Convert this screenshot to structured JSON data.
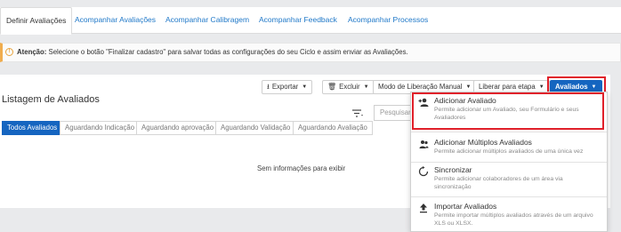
{
  "tabs": [
    {
      "label": "Definir Avaliações",
      "active": true
    },
    {
      "label": "Acompanhar Avaliações",
      "active": false
    },
    {
      "label": "Acompanhar Calibragem",
      "active": false
    },
    {
      "label": "Acompanhar Feedback",
      "active": false
    },
    {
      "label": "Acompanhar Processos",
      "active": false
    }
  ],
  "alert": {
    "icon": "info-icon",
    "title": "Atenção:",
    "text": " Selecione o botão \"Finalizar cadastro\" para salvar todas as configurações do seu Ciclo e assim enviar as Avaliações."
  },
  "panel": {
    "title": "Listagem de Avaliados",
    "toolbar": {
      "export_label": "Exportar",
      "delete_label": "Excluir",
      "release_mode_label": "Modo de Liberação Manual",
      "release_stage_label": "Liberar para etapa",
      "evaluated_label": "Avaliados"
    },
    "search_placeholder": "Pesquisar",
    "subtabs": [
      {
        "label": "Todos Avaliados",
        "active": true
      },
      {
        "label": "Aguardando Indicação",
        "active": false
      },
      {
        "label": "Aguardando aprovação",
        "active": false
      },
      {
        "label": "Aguardando Validação",
        "active": false
      },
      {
        "label": "Aguardando Avaliação",
        "active": false
      }
    ],
    "empty_message": "Sem informações para exibir"
  },
  "menu": {
    "items": [
      {
        "icon": "add-person-icon",
        "title": "Adicionar Avaliado",
        "description": "Permite adicionar um Avaliado, seu Formulário e seus Avaliadores"
      },
      {
        "icon": "add-group-icon",
        "title": "Adicionar Múltiplos Avaliados",
        "description": "Permite adicionar múltiplos avaliados de uma única vez"
      },
      {
        "icon": "sync-icon",
        "title": "Sincronizar",
        "description": "Permite adicionar colaboradores de um área via sincronização"
      },
      {
        "icon": "upload-icon",
        "title": "Importar Avaliados",
        "description": "Permite importar múltiplos avaliados através de um arquivo XLS ou XLSX."
      }
    ]
  },
  "colors": {
    "primary": "#1565c0",
    "link": "#1f78c8",
    "highlight": "#e0202a",
    "warning": "#f0ad4e"
  }
}
